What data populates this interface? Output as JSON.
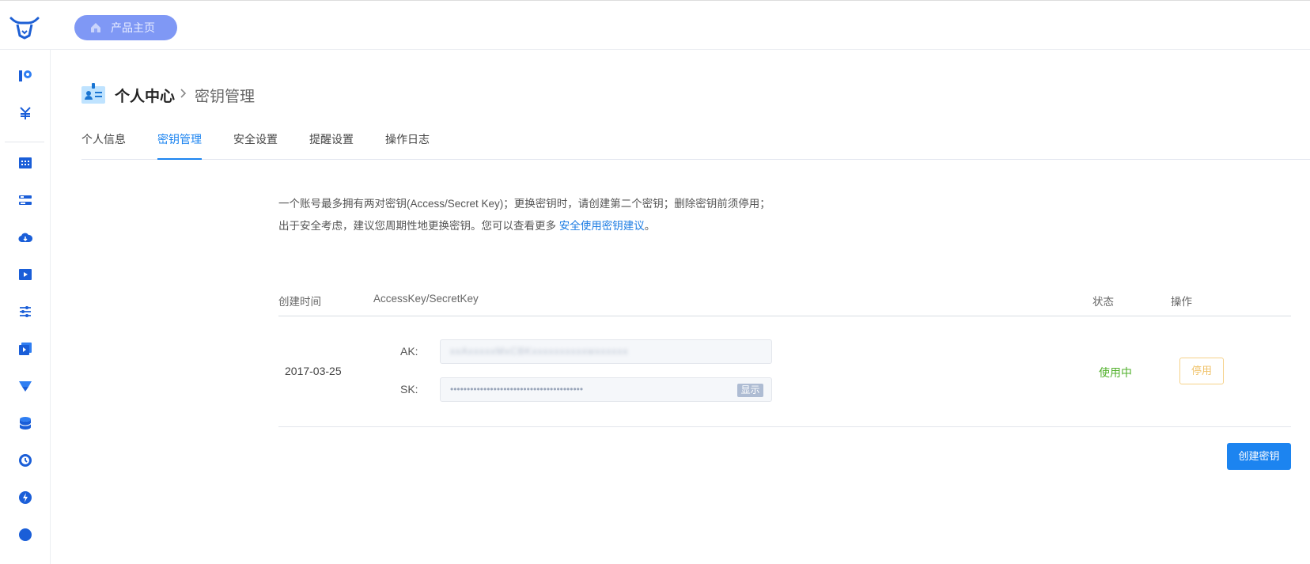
{
  "header": {
    "home_label": "产品主页"
  },
  "sidebar": {
    "icons": [
      "dashboard-icon",
      "billing-yuan-icon",
      "grid-icon",
      "server-list-icon",
      "cloud-icon",
      "media-icon",
      "settings-sliders-icon",
      "video-icon",
      "cdn-icon",
      "database-icon",
      "time-icon",
      "lightning-icon",
      "globe-icon"
    ]
  },
  "breadcrumb": {
    "root": "个人中心",
    "current": "密钥管理"
  },
  "tabs": [
    {
      "label": "个人信息",
      "active": false
    },
    {
      "label": "密钥管理",
      "active": true
    },
    {
      "label": "安全设置",
      "active": false
    },
    {
      "label": "提醒设置",
      "active": false
    },
    {
      "label": "操作日志",
      "active": false
    }
  ],
  "description": {
    "text": "一个账号最多拥有两对密钥(Access/Secret Key)；更换密钥时，请创建第二个密钥；删除密钥前须停用；出于安全考虑，建议您周期性地更换密钥。您可以查看更多",
    "link": "安全使用密钥建议",
    "end": "。"
  },
  "table": {
    "headers": {
      "created": "创建时间",
      "keys": "AccessKey/SecretKey",
      "status": "状态",
      "actions": "操作"
    },
    "rows": [
      {
        "created": "2017-03-25",
        "ak_label": "AK:",
        "ak_value": "xxAxxxxxMxCBKxxxxxxxxxxwxxxxxx",
        "sk_label": "SK:",
        "sk_value": "••••••••••••••••••••••••••••••••••••••••",
        "show_label": "显示",
        "status": "使用中",
        "action_label": "停用"
      }
    ]
  },
  "create_button": "创建密钥",
  "colors": {
    "accent": "#1c84f0",
    "status_active": "#52b12c",
    "warning": "#f0c36b",
    "pill": "#7f98f5"
  }
}
